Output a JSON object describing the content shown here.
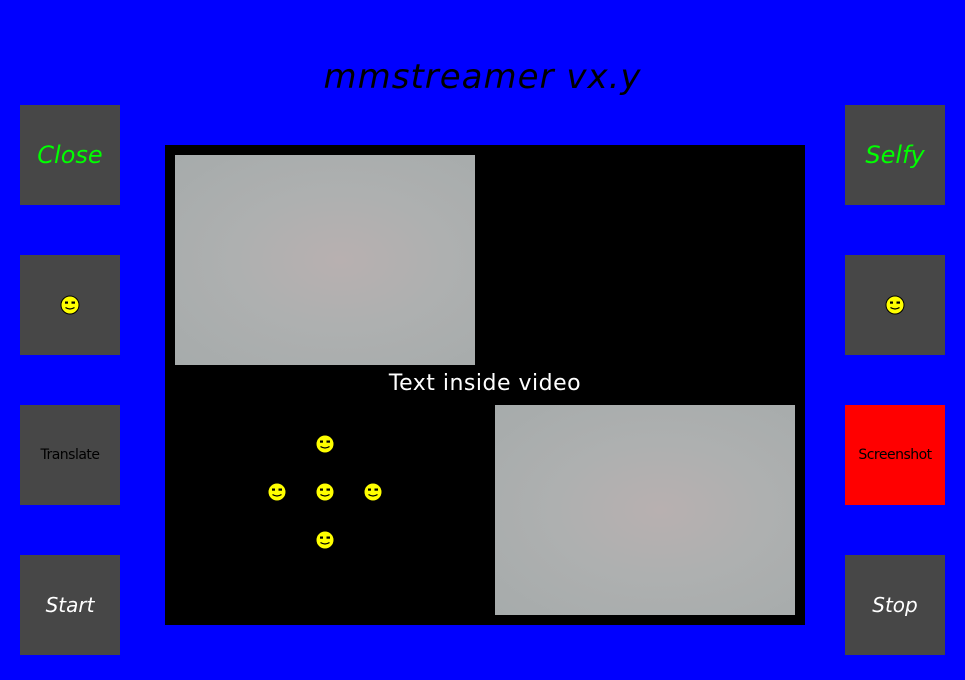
{
  "app": {
    "title": "mmstreamer vx.y"
  },
  "left_buttons": {
    "close": {
      "label": "Close",
      "color": "#00ff00"
    },
    "emoji_left": {
      "icon": "smiley-icon"
    },
    "translate": {
      "label": "Translate",
      "color": "#000000"
    },
    "start": {
      "label": "Start",
      "color": "#ffffff"
    }
  },
  "right_buttons": {
    "selfy": {
      "label": "Selfy",
      "color": "#00ff00"
    },
    "emoji_right": {
      "icon": "smiley-icon"
    },
    "screenshot": {
      "label": "Screenshot",
      "color": "#000000",
      "background": "#ff0000"
    },
    "stop": {
      "label": "Stop",
      "color": "#ffffff"
    }
  },
  "video": {
    "overlay_text": "Text inside video",
    "feeds": [
      "camera-feed-1",
      "camera-feed-2"
    ],
    "dpad_icons": [
      "smiley-up",
      "smiley-left",
      "smiley-center",
      "smiley-right",
      "smiley-down"
    ]
  },
  "colors": {
    "background": "#0000ff",
    "button": "#474747",
    "accent_green": "#00ff00",
    "screenshot_red": "#ff0000",
    "smiley_yellow": "#ffff00"
  }
}
